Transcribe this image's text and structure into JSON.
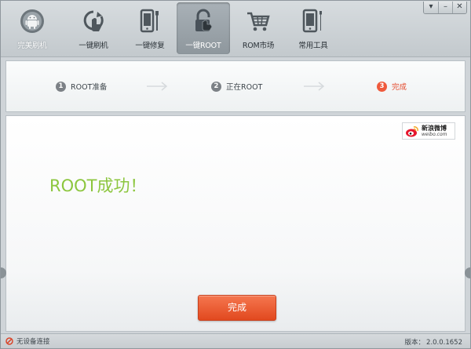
{
  "toolbar": {
    "items": [
      {
        "label": "完美刷机",
        "icon": "android-icon"
      },
      {
        "label": "一键刷机",
        "icon": "refresh-phone-icon"
      },
      {
        "label": "一键修复",
        "icon": "repair-phone-icon"
      },
      {
        "label": "一键ROOT",
        "icon": "lock-icon"
      },
      {
        "label": "ROM市场",
        "icon": "cart-icon"
      },
      {
        "label": "常用工具",
        "icon": "tools-phone-icon"
      }
    ],
    "active_index": 3
  },
  "window_controls": {
    "menu": "▾",
    "minimize": "–",
    "close": "✕"
  },
  "steps": [
    {
      "num": "1",
      "label": "ROOT准备"
    },
    {
      "num": "2",
      "label": "正在ROOT"
    },
    {
      "num": "3",
      "label": "完成"
    }
  ],
  "current_step": 3,
  "weibo": {
    "cn": "新浪微博",
    "en": "weibo.com"
  },
  "result": {
    "message": "ROOT成功！"
  },
  "done_button": "完成",
  "status": {
    "connection": "无设备连接",
    "version_label": "版本：",
    "version": "2.0.0.1652"
  },
  "colors": {
    "accent": "#e4482a",
    "success": "#8cc63e",
    "step_inactive": "#7c8186"
  }
}
